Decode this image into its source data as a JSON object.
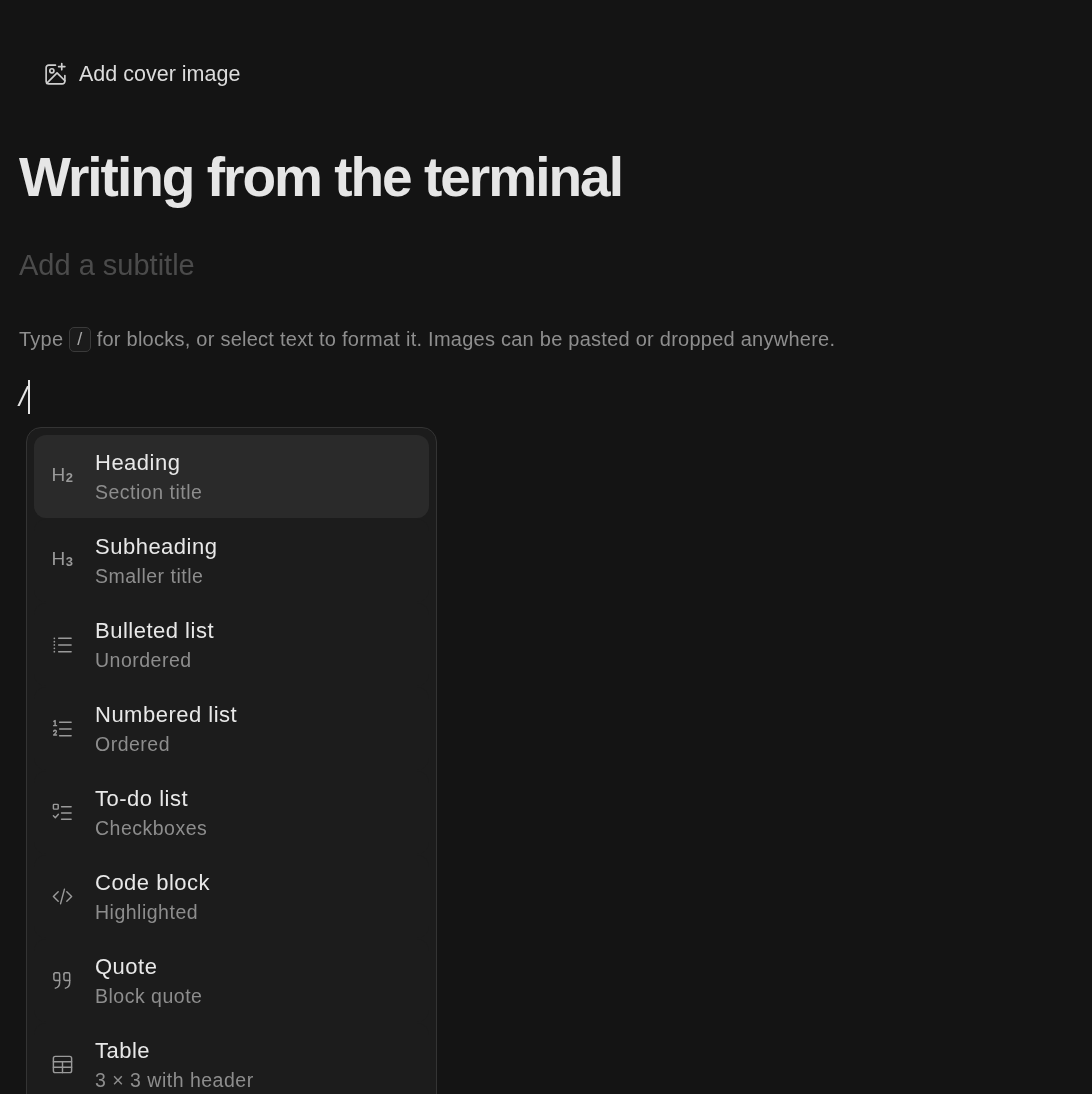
{
  "cover_button": {
    "label": "Add cover image"
  },
  "title": "Writing from the terminal",
  "subtitle": {
    "placeholder": "Add a subtitle"
  },
  "hint": {
    "before": "Type",
    "key": "/",
    "after": "for blocks, or select text to format it. Images can be pasted or dropped anywhere."
  },
  "editor_line": {
    "value": "/"
  },
  "slash_menu": {
    "items": [
      {
        "kind": "heading",
        "glyph": "H$_{2}$",
        "title": "Heading",
        "description": "Section title",
        "selected": true
      },
      {
        "kind": "heading",
        "glyph": "H$_{3}$",
        "title": "Subheading",
        "description": "Smaller title",
        "selected": false
      },
      {
        "kind": "bulleted",
        "title": "Bulleted list",
        "description": "Unordered",
        "selected": false
      },
      {
        "kind": "numbered",
        "title": "Numbered list",
        "description": "Ordered",
        "selected": false
      },
      {
        "kind": "todo",
        "title": "To-do list",
        "description": "Checkboxes",
        "selected": false
      },
      {
        "kind": "code",
        "title": "Code block",
        "description": "Highlighted",
        "selected": false
      },
      {
        "kind": "quote",
        "title": "Quote",
        "description": "Block quote",
        "selected": false
      },
      {
        "kind": "table",
        "title": "Table",
        "description": "3 × 3 with header",
        "selected": false
      }
    ]
  }
}
